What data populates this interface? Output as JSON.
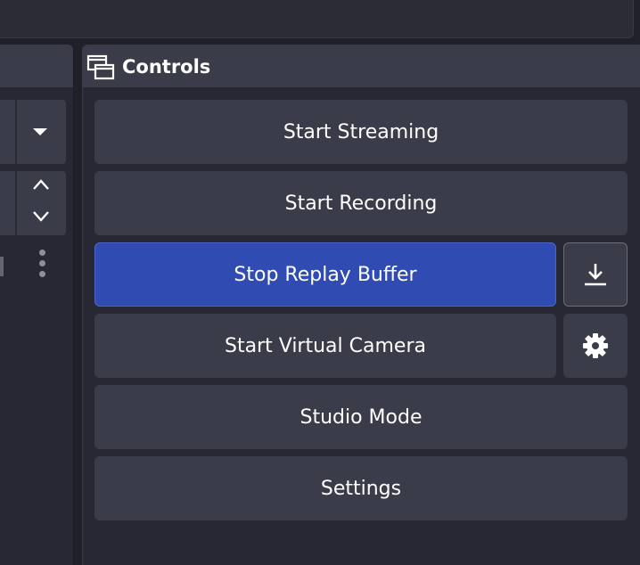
{
  "controls": {
    "title": "Controls",
    "dock_icon": "window-dock-icon",
    "buttons": {
      "streaming": "Start Streaming",
      "recording": "Start Recording",
      "replay": "Stop Replay Buffer",
      "virtual_camera": "Start Virtual Camera",
      "studio_mode": "Studio Mode",
      "settings": "Settings"
    },
    "replay_active_color": "#304bb2",
    "save_replay_icon": "download-icon",
    "virtual_camera_settings_icon": "gear-icon"
  },
  "left_dock": {
    "combo_icon": "chevron-down-icon",
    "spin_icons": [
      "chevron-up-icon",
      "chevron-down-icon"
    ],
    "more_icon": "more-vertical-icon"
  },
  "colors": {
    "background": "#1f2028",
    "panel": "#272833",
    "button": "#3b3c4a",
    "accent": "#304bb2"
  }
}
